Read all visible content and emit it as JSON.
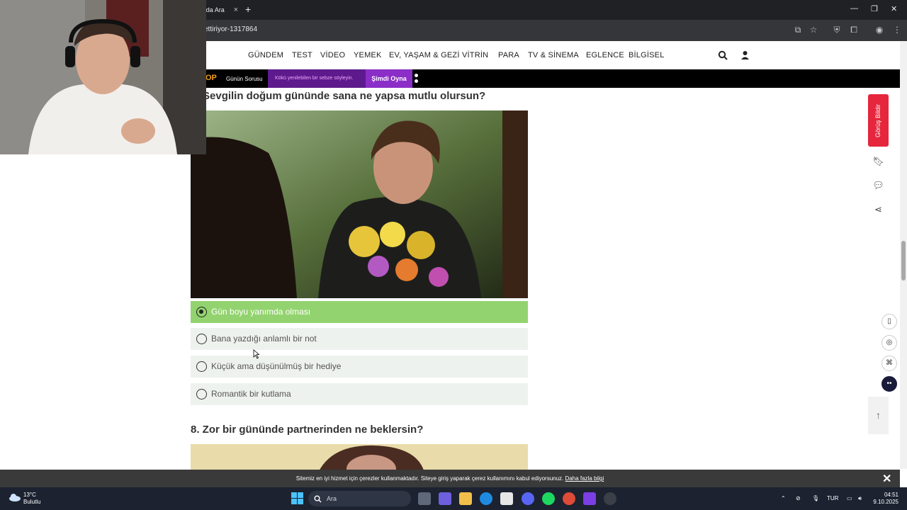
{
  "browser": {
    "tab_title": "'da Ara",
    "url": "ettiriyor-1317864"
  },
  "nav": {
    "items": [
      "GÜNDEM",
      "TEST",
      "VİDEO",
      "YEMEK",
      "EV, YAŞAM & GEZİ",
      "VİTRİN",
      "PARA",
      "TV & SİNEMA",
      "EGLENCE",
      "BİLGİSEL"
    ]
  },
  "banner": {
    "logo": "OP",
    "question_label": "Günün Sorusu",
    "question_text": "Kökü yenilebilen bir sebze söyleyin.",
    "play_label": "Şimdi Oyna"
  },
  "question7": {
    "title": "Sevgilin doğum gününde sana ne yapsa mutlu olursun?",
    "options": [
      {
        "label": "Gün boyu yanımda olması",
        "selected": true
      },
      {
        "label": "Bana yazdığı anlamlı bir not",
        "selected": false
      },
      {
        "label": "Küçük ama düşünülmüş bir hediye",
        "selected": false
      },
      {
        "label": "Romantik bir kutlama",
        "selected": false
      }
    ]
  },
  "question8": {
    "title": "8. Zor bir gününde partnerinden ne beklersin?"
  },
  "rail": {
    "feedback_label": "Görüş Bildir"
  },
  "cookie": {
    "text": "Sitemiz en iyi hizmet için çerezler kullanmaktadır. Siteye giriş yaparak çerez kullanımını kabul ediyorsunuz.",
    "link": "Daha fazla bilgi"
  },
  "taskbar": {
    "weather_temp": "13°C",
    "weather_desc": "Bulutlu",
    "search_placeholder": "Ara",
    "language": "TUR",
    "time": "04:51",
    "date": "9.10.2025"
  },
  "colors": {
    "selected_option": "#93d36f",
    "feedback": "#e5263d",
    "banner_purple": "#5d1a8c"
  }
}
